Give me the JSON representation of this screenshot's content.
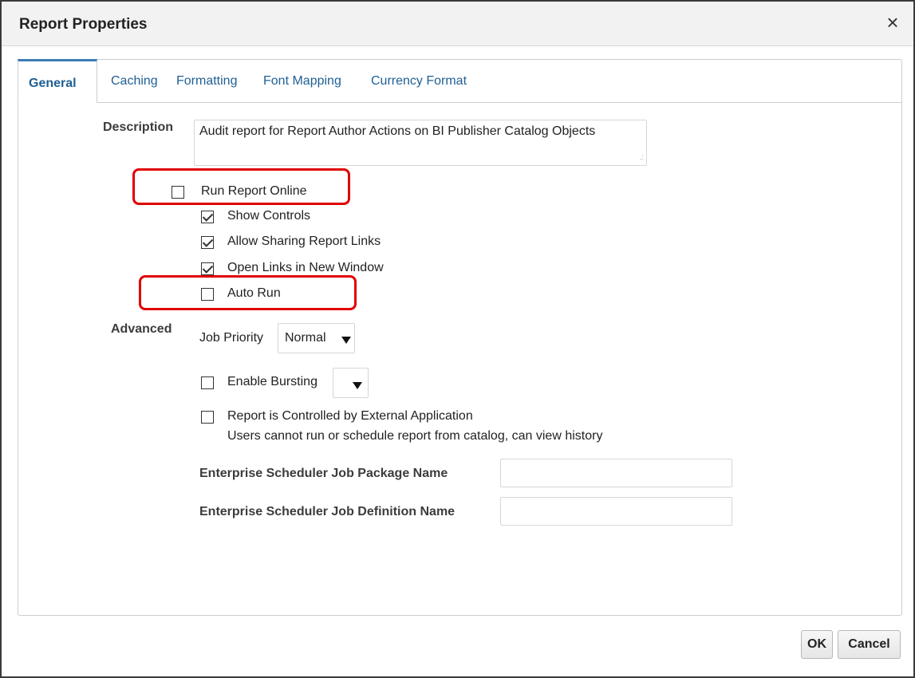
{
  "dialog": {
    "title": "Report Properties",
    "close_icon": "close-icon"
  },
  "tabs": [
    {
      "label": "General",
      "active": true
    },
    {
      "label": "Caching",
      "active": false
    },
    {
      "label": "Formatting",
      "active": false
    },
    {
      "label": "Font Mapping",
      "active": false
    },
    {
      "label": "Currency Format",
      "active": false
    }
  ],
  "general": {
    "description_label": "Description",
    "description_value": "Audit report for Report Author Actions on BI Publisher Catalog Objects",
    "options": [
      {
        "label": "Run Report Online",
        "checked": false,
        "highlighted": true
      },
      {
        "label": "Show Controls",
        "checked": true,
        "highlighted": false
      },
      {
        "label": "Allow Sharing Report Links",
        "checked": true,
        "highlighted": false
      },
      {
        "label": "Open Links in New Window",
        "checked": true,
        "highlighted": false
      },
      {
        "label": "Auto Run",
        "checked": false,
        "highlighted": true
      }
    ],
    "advanced_label": "Advanced",
    "job_priority_label": "Job Priority",
    "job_priority_value": "Normal",
    "enable_bursting_label": "Enable Bursting",
    "enable_bursting_checked": false,
    "external_app_label": "Report is Controlled by External Application",
    "external_app_note": "Users cannot run or schedule report from catalog, can view history",
    "external_app_checked": false,
    "ess_package_label": "Enterprise Scheduler Job Package Name",
    "ess_package_value": "",
    "ess_definition_label": "Enterprise Scheduler Job Definition Name",
    "ess_definition_value": ""
  },
  "footer": {
    "ok_label": "OK",
    "cancel_label": "Cancel"
  },
  "colors": {
    "highlight": "#e00000",
    "tab_link": "#1f5f93",
    "active_tab_border": "#3e7bb6"
  }
}
